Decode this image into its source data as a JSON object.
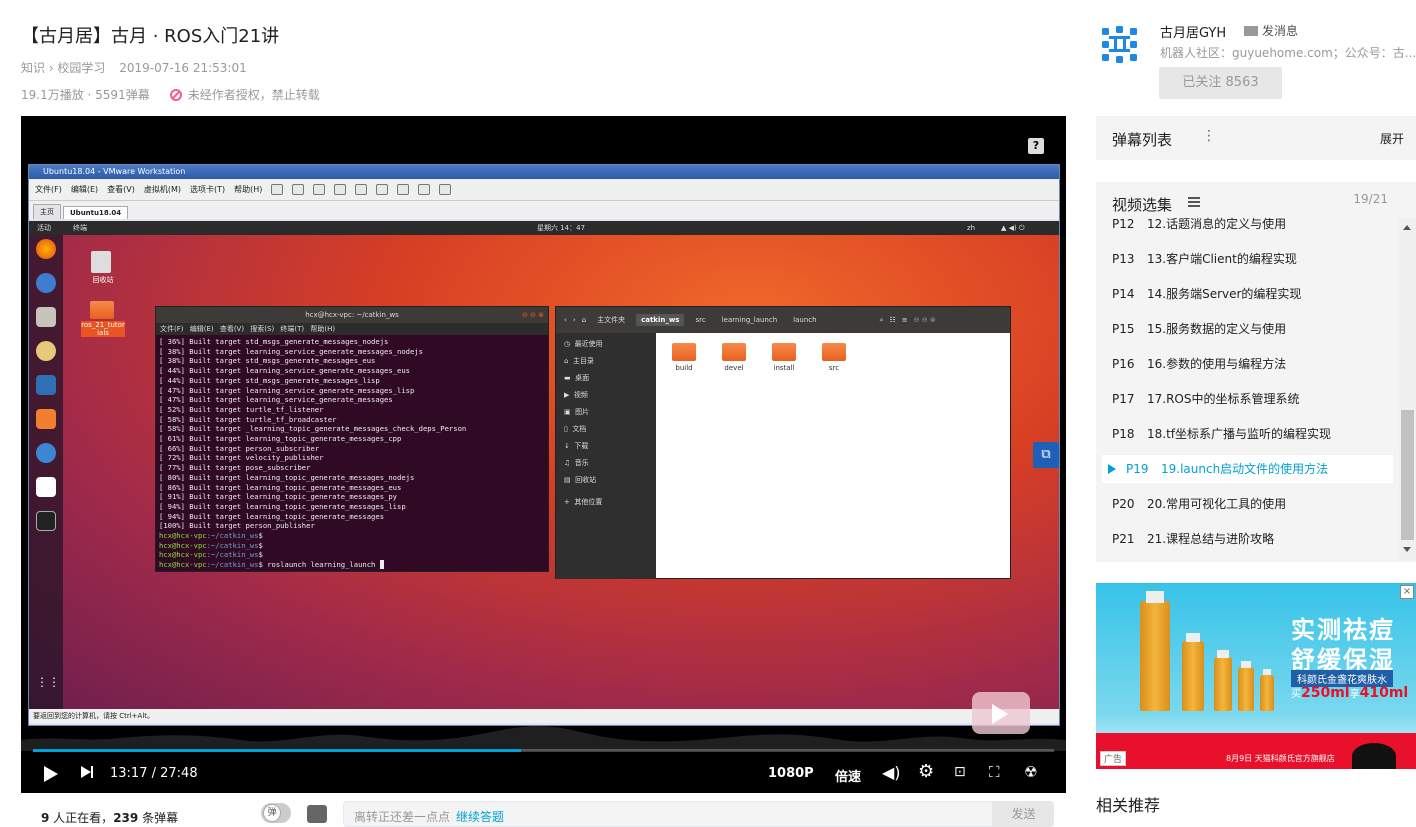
{
  "video": {
    "title": "【古月居】古月 · ROS入门21讲",
    "category": "知识 › 校园学习",
    "datetime": "2019-07-16 21:53:01",
    "stats": "19.1万播放 · 5591弹幕",
    "copyright": "未经作者授权，禁止转载"
  },
  "vm": {
    "window_title": "Ubuntu18.04 - VMware Workstation",
    "menu": [
      "文件(F)",
      "编辑(E)",
      "查看(V)",
      "虚拟机(M)",
      "选项卡(T)",
      "帮助(H)"
    ],
    "tabs": [
      "主页",
      "Ubuntu18.04"
    ],
    "status": "要返回到您的计算机，请按 Ctrl+Alt。"
  },
  "ubuntu": {
    "activities": "活动",
    "terminal_app": "终端",
    "clock": "星期六 14：47",
    "lang": "zh",
    "desktop_icons": [
      "回收站",
      "ros_21_tutorials"
    ],
    "terminal": {
      "title": "hcx@hcx-vpc: ~/catkin_ws",
      "menu": "文件(F) 编辑(E) 查看(V) 搜索(S) 终端(T) 帮助(H)",
      "lines": [
        "[ 36%] Built target std_msgs_generate_messages_nodejs",
        "[ 38%] Built target learning_service_generate_messages_nodejs",
        "[ 38%] Built target std_msgs_generate_messages_eus",
        "[ 44%] Built target learning_service_generate_messages_eus",
        "[ 44%] Built target std_msgs_generate_messages_lisp",
        "[ 47%] Built target learning_service_generate_messages_lisp",
        "[ 47%] Built target learning_service_generate_messages",
        "[ 52%] Built target turtle_tf_listener",
        "[ 58%] Built target turtle_tf_broadcaster",
        "[ 58%] Built target _learning_topic_generate_messages_check_deps_Person",
        "[ 61%] Built target learning_topic_generate_messages_cpp",
        "[ 66%] Built target person_subscriber",
        "[ 72%] Built target velocity_publisher",
        "[ 77%] Built target pose_subscriber",
        "[ 80%] Built target learning_topic_generate_messages_nodejs",
        "[ 86%] Built target learning_topic_generate_messages_eus",
        "[ 91%] Built target learning_topic_generate_messages_py",
        "[ 94%] Built target learning_topic_generate_messages_lisp",
        "[ 94%] Built target learning_topic_generate_messages",
        "[100%] Built target person_publisher"
      ],
      "prompt_user": "hcx@hcx-vpc",
      "prompt_path": ":~/catkin_ws",
      "last_command": " roslaunch learning_launch "
    },
    "files": {
      "breadcrumbs": [
        "主文件夹",
        "catkin_ws",
        "src",
        "learning_launch",
        "launch"
      ],
      "sidebar": [
        "最近使用",
        "主目录",
        "桌面",
        "视频",
        "图片",
        "文档",
        "下载",
        "音乐",
        "回收站",
        "其他位置"
      ],
      "folders": [
        "build",
        "devel",
        "install",
        "src"
      ]
    }
  },
  "player": {
    "current_time": "13:17",
    "duration": "27:48",
    "time_sep": " / ",
    "progress": 0.478,
    "quality": "1080P",
    "speed": "倍速",
    "accent": "#00a1d6"
  },
  "danmaku_bar": {
    "viewers_count": "9",
    "viewers_text": " 人正在看，",
    "danmaku_count": "239",
    "danmaku_text": " 条弹幕",
    "toggle_label": "弹",
    "input_placeholder": "离转正还差一点点",
    "continue_link": "继续答题",
    "send_label": "发送"
  },
  "uploader": {
    "name": "古月居GYH",
    "message_label": "发消息",
    "description": "机器人社区：guyuehome.com；公众号：古...",
    "follow_label": "已关注 8563"
  },
  "danmu_list": {
    "title": "弹幕列表",
    "expand": "展开"
  },
  "episodes": {
    "title": "视频选集",
    "counter": "19/21",
    "items": [
      {
        "p": "P12",
        "title": "12.话题消息的定义与使用"
      },
      {
        "p": "P13",
        "title": "13.客户端Client的编程实现"
      },
      {
        "p": "P14",
        "title": "14.服务端Server的编程实现"
      },
      {
        "p": "P15",
        "title": "15.服务数据的定义与使用"
      },
      {
        "p": "P16",
        "title": "16.参数的使用与编程方法"
      },
      {
        "p": "P17",
        "title": "17.ROS中的坐标系管理系统"
      },
      {
        "p": "P18",
        "title": "18.tf坐标系广播与监听的编程实现"
      },
      {
        "p": "P19",
        "title": "19.launch启动文件的使用方法"
      },
      {
        "p": "P20",
        "title": "20.常用可视化工具的使用"
      },
      {
        "p": "P21",
        "title": "21.课程总结与进阶攻略"
      }
    ],
    "active_index": 7
  },
  "ad": {
    "headline1": "实测祛痘",
    "headline2": "舒缓保湿",
    "tag": "科颜氏金盏花爽肤水",
    "price_prefix": "买",
    "price_a": "250ml",
    "price_mid": "享",
    "price_b": "410ml",
    "label": "广告",
    "footer": "8月9日 天猫科颜氏官方旗舰店"
  },
  "related": {
    "title": "相关推荐"
  }
}
